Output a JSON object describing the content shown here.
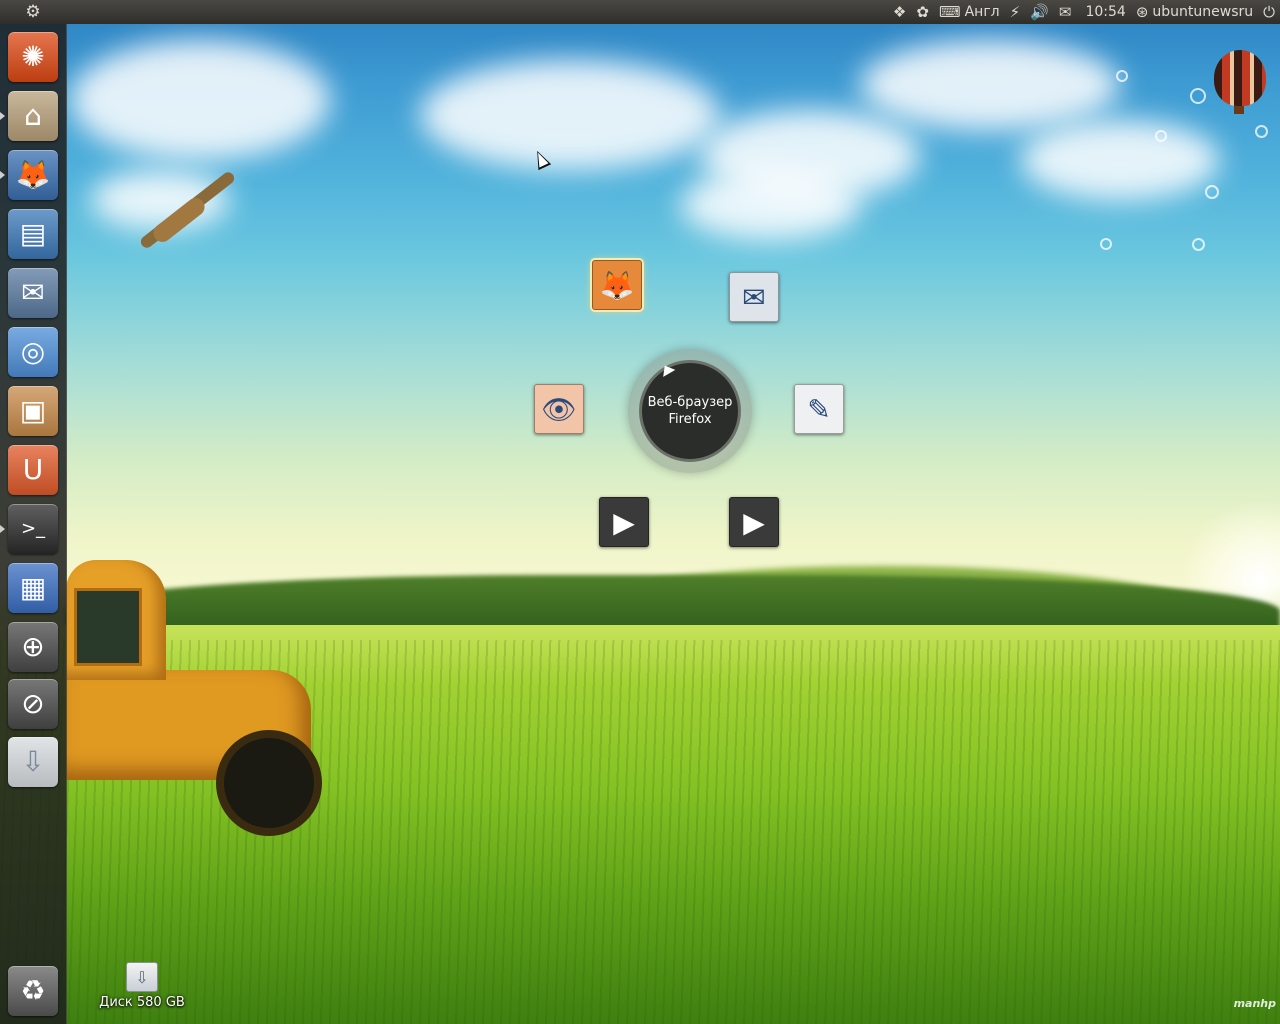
{
  "top_panel": {
    "session_icon": "ubuntu-session-icon",
    "indicators": [
      {
        "icon": "dropbox-icon",
        "glyph": "❖",
        "text": ""
      },
      {
        "icon": "messaging-icon",
        "glyph": "✿",
        "text": ""
      },
      {
        "icon": "keyboard-icon",
        "glyph": "⌨",
        "text": "Англ"
      },
      {
        "icon": "network-icon",
        "glyph": "⚡",
        "text": ""
      },
      {
        "icon": "volume-icon",
        "glyph": "🔊",
        "text": ""
      },
      {
        "icon": "mail-icon",
        "glyph": "✉",
        "text": ""
      }
    ],
    "clock": "10:54",
    "user": "ubuntunewsru",
    "power_glyph": "⏻"
  },
  "launcher": {
    "items": [
      {
        "name": "dash-home",
        "glyph": "✺",
        "color": "#dd4814"
      },
      {
        "name": "home-folder",
        "glyph": "⌂",
        "color": "#b8a07a"
      },
      {
        "name": "firefox",
        "glyph": "🦊",
        "color": "#3a6fb0"
      },
      {
        "name": "libreoffice-writer",
        "glyph": "▤",
        "color": "#3c78b8"
      },
      {
        "name": "thunderbird",
        "glyph": "✉",
        "color": "#5a7aa0"
      },
      {
        "name": "chromium",
        "glyph": "◎",
        "color": "#4d8fd8"
      },
      {
        "name": "software-center",
        "glyph": "▣",
        "color": "#c88a4a"
      },
      {
        "name": "ubuntu-one",
        "glyph": "U",
        "color": "#e05a2a"
      },
      {
        "name": "terminal",
        "glyph": ">_",
        "color": "#2b2b2b"
      },
      {
        "name": "workspace-switcher",
        "glyph": "▦",
        "color": "#3a6ec2"
      },
      {
        "name": "magnifier",
        "glyph": "⊕",
        "color": "#4a4a4a"
      },
      {
        "name": "lens-files",
        "glyph": "⊘",
        "color": "#4a4a4a"
      },
      {
        "name": "usb-drive",
        "glyph": "⇩",
        "color": "#d8dce0"
      }
    ],
    "trash_glyph": "♻"
  },
  "radial_menu": {
    "center_label_line1": "Веб-браузер",
    "center_label_line2": "Firefox",
    "items": [
      {
        "name": "firefox",
        "glyph": "🦊",
        "bg": "#e7893a"
      },
      {
        "name": "thunderbird",
        "glyph": "✉",
        "bg": "#dfe4ea"
      },
      {
        "name": "eye-of-gnome",
        "glyph": "👁",
        "bg": "#f2c4a8"
      },
      {
        "name": "gedit",
        "glyph": "✎",
        "bg": "#eef0f2"
      },
      {
        "name": "video-player-1",
        "glyph": "▶",
        "bg": "#3a3a3a"
      },
      {
        "name": "video-player-2",
        "glyph": "▶",
        "bg": "#3a3a3a"
      }
    ]
  },
  "desktop_icons": [
    {
      "label": "Диск 580 GB",
      "glyph": "⇩"
    }
  ],
  "watermark": "manhp"
}
